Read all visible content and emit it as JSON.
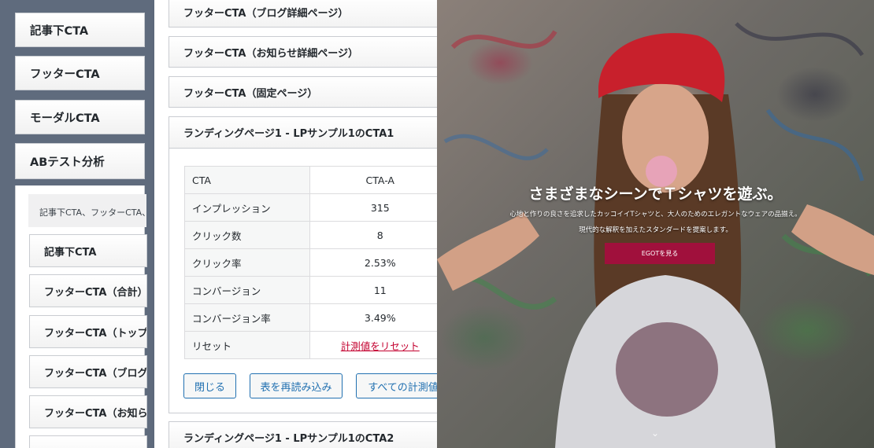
{
  "left_panel": {
    "cards": [
      "記事下CTA",
      "フッターCTA",
      "モーダルCTA",
      "ABテスト分析"
    ],
    "description": "記事下CTA、フッターCTA、",
    "items": [
      "記事下CTA",
      "フッターCTA（合計）",
      "フッターCTA（トップ",
      "フッターCTA（ブログ",
      "フッターCTA（お知ら"
    ]
  },
  "middle_panel": {
    "cards": [
      "フッターCTA（ブログ詳細ページ）",
      "フッターCTA（お知らせ詳細ページ）",
      "フッターCTA（固定ページ）"
    ],
    "open_card_title": "ランディングページ1 - LPサンプル1のCTA1",
    "table": [
      {
        "label": "CTA",
        "value": "CTA-A"
      },
      {
        "label": "インプレッション",
        "value": "315"
      },
      {
        "label": "クリック数",
        "value": "8"
      },
      {
        "label": "クリック率",
        "value": "2.53%"
      },
      {
        "label": "コンバージョン",
        "value": "11"
      },
      {
        "label": "コンバージョン率",
        "value": "3.49%"
      },
      {
        "label": "リセット",
        "value": "計測値をリセット"
      }
    ],
    "buttons": {
      "close": "閉じる",
      "reload": "表を再読み込み",
      "reset_all": "すべての計測値"
    },
    "next_card_title": "ランディングページ1 - LPサンプル1のCTA2"
  },
  "hero": {
    "title": "さまざまなシーンでＴシャツを遊ぶ。",
    "line1": "心地と作りの良さを追求したカッコイイTシャツと、大人のためのエレガントなウェアの品揃え。",
    "line2": "現代的な解釈を加えたスタンダードを提案します。",
    "button": "EGOTを見る",
    "colors": {
      "button": "#a0103c",
      "cap": "#c8202c"
    }
  }
}
